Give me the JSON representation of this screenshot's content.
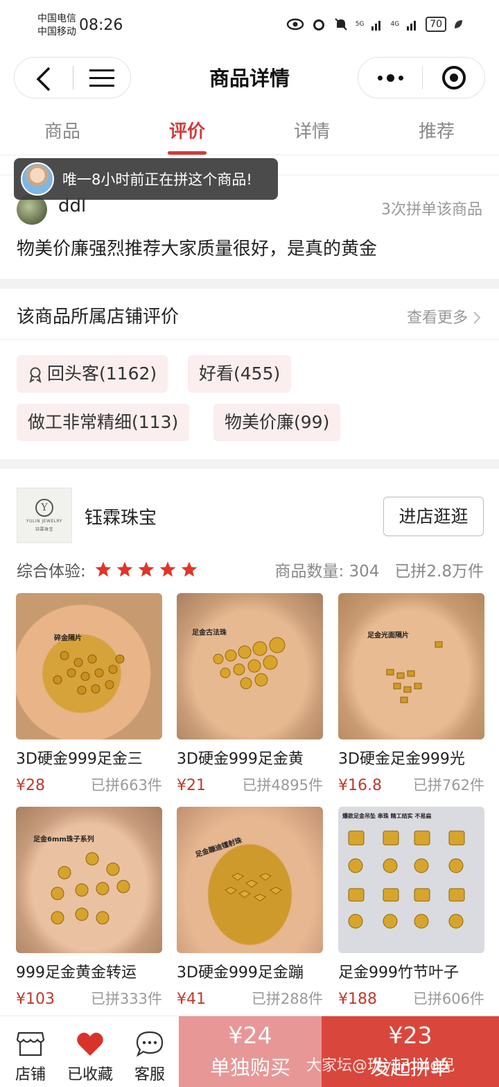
{
  "status_bar": {
    "carrier_1": "中国电信",
    "carrier_2": "中国移动",
    "time": "08:26",
    "signal_1": "5G",
    "signal_2": "4G",
    "battery": "70"
  },
  "nav": {
    "title": "商品详情"
  },
  "tabs": [
    {
      "label": "商品",
      "active": false
    },
    {
      "label": "评价",
      "active": true
    },
    {
      "label": "详情",
      "active": false
    },
    {
      "label": "推荐",
      "active": false
    }
  ],
  "toast": {
    "text": "唯一8小时前正在拼这个商品!"
  },
  "review": {
    "name": "ddl",
    "count": "3次拼单该商品",
    "text": "物美价廉强烈推荐大家质量很好，是真的黄金"
  },
  "shop_rating": {
    "title": "该商品所属店铺评价",
    "more": "查看更多",
    "tags": [
      "回头客(1162)",
      "好看(455)",
      "做工非常精细(113)",
      "物美价廉(99)"
    ]
  },
  "shop": {
    "name": "钰霖珠宝",
    "logo_text": "YULIN JEWELRY",
    "logo_sub": "钰霖珠宝",
    "enter_label": "进店逛逛",
    "experience_label": "综合体验:",
    "stars": 5,
    "product_count": "商品数量: 304",
    "group_count": "已拼2.8万件",
    "products": [
      {
        "name": "3D硬金999足金三",
        "price": "¥28",
        "sold": "已拼663件",
        "img_label": "碎金隔片"
      },
      {
        "name": "3D硬金999足金黄",
        "price": "¥21",
        "sold": "已拼4895件",
        "img_label": "足金古法珠"
      },
      {
        "name": "3D硬金足金999光",
        "price": "¥16.8",
        "sold": "已拼762件",
        "img_label": "足金光面隔片"
      },
      {
        "name": "999足金黄金转运",
        "price": "¥103",
        "sold": "已拼333件",
        "img_label": "足金6mm珠子系列"
      },
      {
        "name": "3D硬金999足金蹦",
        "price": "¥41",
        "sold": "已拼288件",
        "img_label": "足金蹦迪镭射珠"
      },
      {
        "name": "足金999竹节叶子",
        "price": "¥188",
        "sold": "已拼606件",
        "img_label": "爆款足金吊坠 串珠 精工结实 不易扁"
      }
    ]
  },
  "bottom_bar": {
    "store": "店铺",
    "favorited": "已收藏",
    "service": "客服",
    "single_price": "¥24",
    "single_label": "单独购买",
    "group_price": "¥23",
    "group_label": "发起拼单"
  },
  "watermark": "大家坛@珑yuming兒",
  "colors": {
    "accent": "#d23b3b",
    "group_btn": "#d9473c",
    "single_btn": "#e89797",
    "tag_bg": "#fbeeee"
  }
}
